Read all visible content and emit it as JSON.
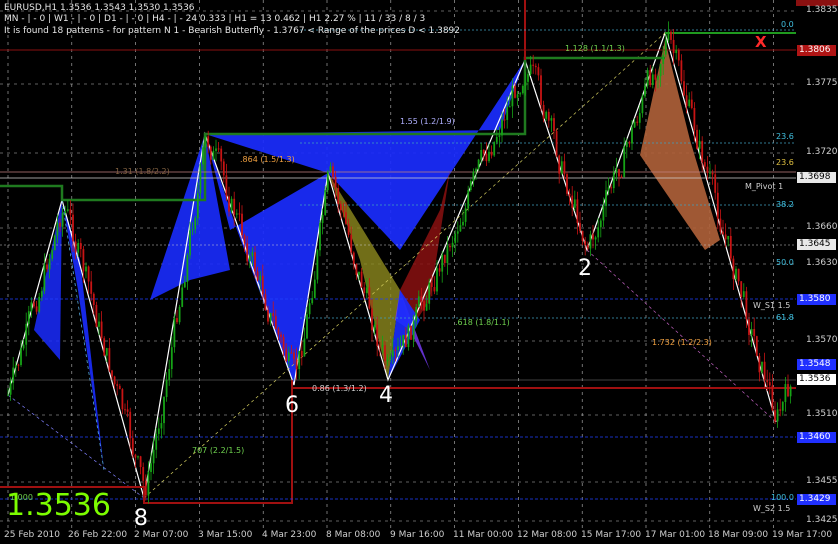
{
  "header": {
    "symbol_line": "EURUSD,H1  1.3536 1.3543 1.3530 1.3536",
    "timeframe_line": "MN - | - 0 | W1 - | - 0 | D1 - | - 0 | H4 - | - 24  0.333 | H1 = 13  0.462 | H1  2.27 % | 11 / 33 / 8 / 3",
    "pattern_line": "It is found 18 patterns  -  for pattern N 1 - Bearish Butterfly - 1.3767 < Range of the prices D < 1.3892"
  },
  "current_price_big": "1.3536",
  "y_axis_ticks": [
    "1.3835",
    "1.3775",
    "1.3720",
    "1.3660",
    "1.3630",
    "1.3570",
    "1.3510",
    "1.3455",
    "1.3425"
  ],
  "price_boxes": {
    "red_top": "1.3806",
    "pivot": "1.3698",
    "level_1645": "1.3645",
    "s1": "1.3580",
    "level_548": "1.3548",
    "current": "1.3536",
    "lower_blue": "1.3460",
    "s2": "1.3429"
  },
  "fib_labels": {
    "f0": "0.0",
    "f236": "23.6",
    "f236b": "23.6",
    "f382": "38.2",
    "f500": "50.0",
    "f618": "61.8",
    "f100": "100.0"
  },
  "pivot_labels": {
    "m_pivot": "M_Pivot 1",
    "w_s1": "W_S1 1.5",
    "w_s2": "W_S2 1.5"
  },
  "x_axis_ticks": [
    "25 Feb 2010",
    "26 Feb 22:00",
    "2 Mar 07:00",
    "3 Mar 15:00",
    "4 Mar 23:00",
    "8 Mar 08:00",
    "9 Mar 16:00",
    "11 Mar 00:00",
    "12 Mar 08:00",
    "15 Mar 17:00",
    "17 Mar 01:00",
    "18 Mar 09:00",
    "19 Mar 17:00"
  ],
  "point_labels": [
    "8",
    "6",
    "4",
    "2"
  ],
  "ratio_notes": {
    "n1": "1.128 (1.1/1.3)",
    "n2": "1.55 (1.2/1.9)",
    "n3": ".864 (1.5/1.3)",
    "n4": "1.31 (1.8/2.2)",
    "n5": ".618 (1.8/1.1)",
    "n6": "1.732 (1.2/2.3)",
    "n7": "0.86 (1.3/1.2)",
    "n8": "707 (2.2/1.5)",
    "n9": "1.000"
  },
  "signal_marker": "X",
  "colors": {
    "bull_candle": "#16a316",
    "bear_candle": "#c81414",
    "pattern_blue": "#1a2cff",
    "pattern_brown": "#a05a2c",
    "pattern_olive": "#8d8a1e",
    "pattern_maroon": "#8a1010",
    "green_line": "#1f7a1f",
    "accent_green": "#7CFC00"
  }
}
